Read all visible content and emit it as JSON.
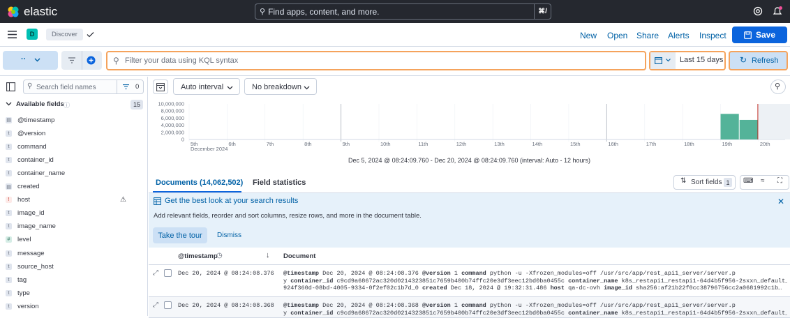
{
  "header": {
    "brand": "elastic",
    "search_placeholder": "Find apps, content, and more.",
    "shortcut": "⌘/"
  },
  "appbar": {
    "space_letter": "D",
    "breadcrumb": "Discover",
    "links": [
      "New",
      "Open",
      "Share",
      "Alerts",
      "Inspect"
    ],
    "save_label": "Save"
  },
  "querybar": {
    "placeholder": "Filter your data using KQL syntax",
    "date_range": "Last 15 days",
    "refresh_label": "Refresh"
  },
  "sidebar": {
    "search_placeholder": "Search field names",
    "filter_count": "0",
    "section_title": "Available fields",
    "section_count": "15",
    "fields": [
      {
        "name": "@timestamp",
        "type": "date"
      },
      {
        "name": "@version",
        "type": "string"
      },
      {
        "name": "command",
        "type": "string"
      },
      {
        "name": "container_id",
        "type": "string"
      },
      {
        "name": "container_name",
        "type": "string"
      },
      {
        "name": "created",
        "type": "date"
      },
      {
        "name": "host",
        "type": "conflict"
      },
      {
        "name": "image_id",
        "type": "string"
      },
      {
        "name": "image_name",
        "type": "string"
      },
      {
        "name": "level",
        "type": "number"
      },
      {
        "name": "message",
        "type": "string"
      },
      {
        "name": "source_host",
        "type": "string"
      },
      {
        "name": "tag",
        "type": "string"
      },
      {
        "name": "type",
        "type": "string"
      },
      {
        "name": "version",
        "type": "string"
      }
    ]
  },
  "chart_toolbar": {
    "interval": "Auto interval",
    "breakdown": "No breakdown"
  },
  "chart_data": {
    "type": "bar",
    "ylim": [
      0,
      10000000
    ],
    "y_ticks": [
      "10,000,000",
      "8,000,000",
      "6,000,000",
      "4,000,000",
      "2,000,000",
      "0"
    ],
    "x_ticks": [
      "5th",
      "6th",
      "7th",
      "8th",
      "9th",
      "10th",
      "11th",
      "12th",
      "13th",
      "14th",
      "15th",
      "16th",
      "17th",
      "18th",
      "19th",
      "20th"
    ],
    "x_sublabel": "December 2024",
    "bars": [
      {
        "x": "Dec 19 @ 20:24",
        "value": 7200000
      },
      {
        "x": "Dec 20 @ 08:24",
        "value": 5500000
      }
    ],
    "range_label": "Dec 5, 2024 @ 08:24:09.760 - Dec 20, 2024 @ 08:24:09.760 (interval: Auto - 12 hours)"
  },
  "tabs": {
    "documents": "Documents (14,062,502)",
    "field_statistics": "Field statistics",
    "sort_fields": "Sort fields",
    "sort_count": "1"
  },
  "callout": {
    "title": "Get the best look at your search results",
    "body": "Add relevant fields, reorder and sort columns, resize rows, and more in the document table.",
    "primary": "Take the tour",
    "secondary": "Dismiss"
  },
  "table": {
    "col_timestamp": "@timestamp",
    "col_document": "Document",
    "rows": [
      {
        "timestamp": "Dec 20, 2024 @ 08:24:08.376",
        "line1": [
          [
            "@timestamp",
            "Dec 20, 2024 @ 08:24:08.376"
          ],
          [
            "@version",
            "1"
          ],
          [
            "command",
            "python -u -Xfrozen_modules=off /usr/src/app/rest_api1_server/server.p"
          ]
        ],
        "line2": [
          [
            "",
            "y"
          ],
          [
            "container_id",
            "c9cd9a68672ac320d0214323851c7659b400b74ffc20e3df3eec12bd0ba0455c"
          ],
          [
            "container_name",
            "k8s_restapi1_restapi1-64d4b5f956-2sxxn_default_"
          ]
        ],
        "line3": [
          [
            "",
            "924f360d-08bd-4005-9334-0f2ef02c1b7d_0"
          ],
          [
            "created",
            "Dec 18, 2024 @ 19:32:31.486"
          ],
          [
            "host",
            "qa-dc-ovh"
          ],
          [
            "image_id",
            "sha256:af21b22f0cc38796756cc2a0681992c1b…"
          ]
        ]
      },
      {
        "timestamp": "Dec 20, 2024 @ 08:24:08.368",
        "line1": [
          [
            "@timestamp",
            "Dec 20, 2024 @ 08:24:08.368"
          ],
          [
            "@version",
            "1"
          ],
          [
            "command",
            "python -u -Xfrozen_modules=off /usr/src/app/rest_api1_server/server.p"
          ]
        ],
        "line2": [
          [
            "",
            "y"
          ],
          [
            "container_id",
            "c9cd9a68672ac320d0214323851c7659b400b74ffc20e3df3eec12bd0ba0455c"
          ],
          [
            "container_name",
            "k8s_restapi1_restapi1-64d4b5f956-2sxxn_default_"
          ]
        ]
      }
    ]
  },
  "colors": {
    "header_bg": "#25282f",
    "link": "#0061a6",
    "primary": "#0b64dd",
    "bar": "#54b399",
    "focus_orange": "#f5a35c",
    "callout_bg": "#e6f1fa"
  }
}
